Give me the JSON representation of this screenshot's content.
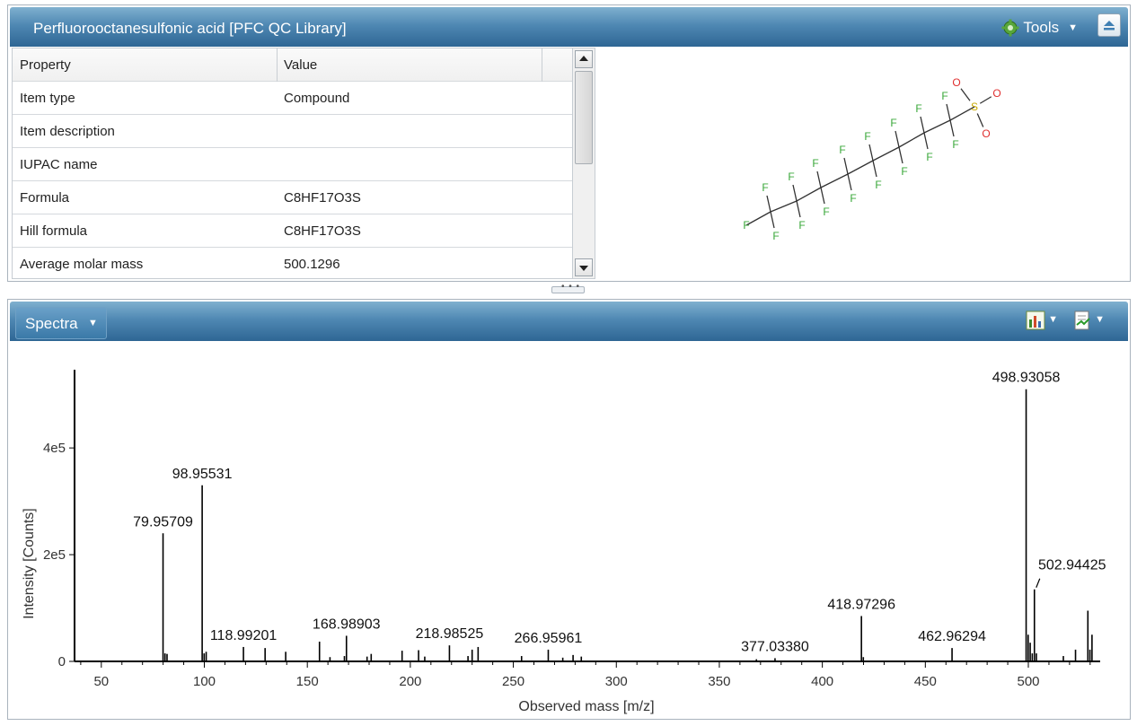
{
  "compound_panel": {
    "title": "Perfluorooctanesulfonic acid  [PFC QC Library]",
    "tools_label": "Tools",
    "icons": {
      "tools": "gear-icon",
      "collapse": "eject-icon"
    }
  },
  "property_grid": {
    "headers": [
      "Property",
      "Value"
    ],
    "rows": [
      {
        "property": "Item type",
        "value": "Compound"
      },
      {
        "property": "Item description",
        "value": ""
      },
      {
        "property": "IUPAC name",
        "value": ""
      },
      {
        "property": "Formula",
        "value": "C8HF17O3S"
      },
      {
        "property": "Hill formula",
        "value": "C8HF17O3S"
      },
      {
        "property": "Average molar mass",
        "value": "500.1296"
      }
    ]
  },
  "molecule": {
    "atoms": {
      "fluorine": "F",
      "sulfur": "S",
      "oxygen": "O"
    },
    "colors": {
      "F": "#3aa83a",
      "S": "#c8a800",
      "O": "#e03030"
    }
  },
  "spectra_panel": {
    "menu_label": "Spectra",
    "icons": [
      "chart-settings-icon",
      "export-icon"
    ]
  },
  "chart_data": {
    "type": "bar",
    "title": "",
    "xlabel": "Observed mass [m/z]",
    "ylabel": "Intensity [Counts]",
    "xlim": [
      37,
      534
    ],
    "ylim": [
      0,
      560000
    ],
    "x_ticks": [
      50,
      100,
      150,
      200,
      250,
      300,
      350,
      400,
      450,
      500
    ],
    "y_ticks": [
      {
        "value": 0,
        "label": "0"
      },
      {
        "value": 200000,
        "label": "2e5"
      },
      {
        "value": 400000,
        "label": "4e5"
      }
    ],
    "labeled_peaks": [
      {
        "x": 79.95709,
        "y": 240000,
        "label": "79.95709"
      },
      {
        "x": 98.95531,
        "y": 330000,
        "label": "98.95531"
      },
      {
        "x": 118.99201,
        "y": 27000,
        "label": "118.99201"
      },
      {
        "x": 168.98903,
        "y": 48000,
        "label": "168.98903"
      },
      {
        "x": 218.98525,
        "y": 30000,
        "label": "218.98525"
      },
      {
        "x": 266.95961,
        "y": 22000,
        "label": "266.95961"
      },
      {
        "x": 377.0338,
        "y": 6000,
        "label": "377.03380"
      },
      {
        "x": 418.97296,
        "y": 85000,
        "label": "418.97296"
      },
      {
        "x": 462.96294,
        "y": 25000,
        "label": "462.96294"
      },
      {
        "x": 498.93058,
        "y": 510000,
        "label": "498.93058"
      },
      {
        "x": 502.94425,
        "y": 135000,
        "label": "502.94425"
      }
    ],
    "other_peaks": [
      {
        "x": 80.9,
        "y": 15000
      },
      {
        "x": 81.9,
        "y": 14000
      },
      {
        "x": 99.9,
        "y": 15000
      },
      {
        "x": 100.9,
        "y": 18000
      },
      {
        "x": 129.5,
        "y": 25000
      },
      {
        "x": 139.5,
        "y": 18000
      },
      {
        "x": 155.9,
        "y": 37000
      },
      {
        "x": 161.0,
        "y": 8000
      },
      {
        "x": 168.0,
        "y": 10000
      },
      {
        "x": 179.0,
        "y": 9000
      },
      {
        "x": 181.0,
        "y": 14000
      },
      {
        "x": 196.0,
        "y": 20000
      },
      {
        "x": 204.0,
        "y": 21000
      },
      {
        "x": 207.0,
        "y": 9000
      },
      {
        "x": 228.0,
        "y": 10000
      },
      {
        "x": 230.0,
        "y": 22000
      },
      {
        "x": 232.9,
        "y": 27000
      },
      {
        "x": 254.0,
        "y": 10000
      },
      {
        "x": 274.0,
        "y": 7000
      },
      {
        "x": 279.0,
        "y": 12000
      },
      {
        "x": 283.0,
        "y": 9000
      },
      {
        "x": 368.0,
        "y": 4000
      },
      {
        "x": 419.9,
        "y": 8000
      },
      {
        "x": 499.9,
        "y": 50000
      },
      {
        "x": 500.9,
        "y": 35000
      },
      {
        "x": 501.9,
        "y": 15000
      },
      {
        "x": 503.9,
        "y": 15000
      },
      {
        "x": 517.0,
        "y": 10000
      },
      {
        "x": 522.9,
        "y": 22000
      },
      {
        "x": 528.9,
        "y": 95000
      },
      {
        "x": 529.9,
        "y": 22000
      },
      {
        "x": 530.9,
        "y": 50000
      }
    ],
    "colors": {
      "peaks": "#000000",
      "axis": "#000000"
    }
  }
}
